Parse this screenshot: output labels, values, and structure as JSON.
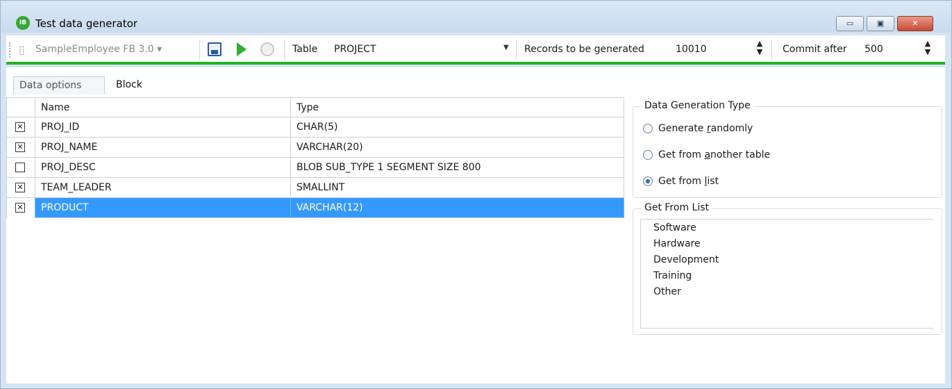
{
  "window": {
    "title": "Test data generator",
    "app_icon_text": "IB",
    "controls": {
      "minimize": "▭",
      "maximize": "▣",
      "close": "✕"
    }
  },
  "toolbar": {
    "database": "SampleEmployee FB 3.0",
    "database_arrow": "▾",
    "table_label": "Table",
    "table_value": "PROJECT",
    "records_label": "Records to be generated",
    "records_value": "10010",
    "commit_label": "Commit after",
    "commit_value": "500",
    "icons": [
      "database-icon",
      "save-icon",
      "run-icon",
      "stop-icon"
    ]
  },
  "tabs": [
    {
      "label": "Data options",
      "active": true
    },
    {
      "label": "Block",
      "active": false
    }
  ],
  "grid": {
    "columns": [
      "Name",
      "Type"
    ],
    "rows": [
      {
        "checked": true,
        "name": "PROJ_ID",
        "type": "CHAR(5)",
        "selected": false
      },
      {
        "checked": true,
        "name": "PROJ_NAME",
        "type": "VARCHAR(20)",
        "selected": false
      },
      {
        "checked": false,
        "name": "PROJ_DESC",
        "type": "BLOB SUB_TYPE 1 SEGMENT SIZE 800",
        "selected": false
      },
      {
        "checked": true,
        "name": "TEAM_LEADER",
        "type": "SMALLINT",
        "selected": false
      },
      {
        "checked": true,
        "name": "PRODUCT",
        "type": "VARCHAR(12)",
        "selected": true
      }
    ]
  },
  "data_generation_type": {
    "title": "Data Generation Type",
    "options": [
      {
        "pre": "Generate ",
        "key": "r",
        "post": "andomly",
        "selected": false
      },
      {
        "pre": "Get from ",
        "key": "a",
        "post": "nother table",
        "selected": false
      },
      {
        "pre": "Get from ",
        "key": "l",
        "post": "ist",
        "selected": true
      }
    ]
  },
  "get_from_list": {
    "title": "Get From List",
    "items": [
      "Software",
      "Hardware",
      "Development",
      "Training",
      "Other"
    ]
  },
  "colors": {
    "accent_green": "#22b522",
    "selection_blue": "#3399ff",
    "window_frame": "#d7e4f2"
  }
}
